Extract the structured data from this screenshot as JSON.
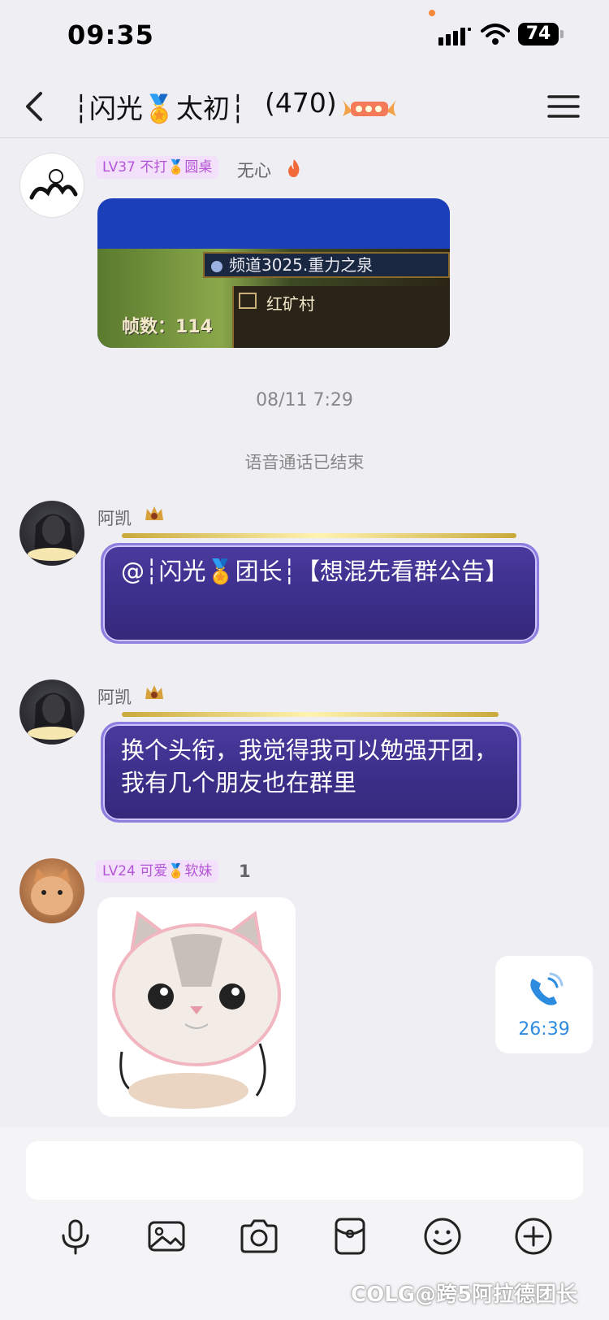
{
  "status_bar": {
    "time": "09:35",
    "battery": "74"
  },
  "header": {
    "title": "┆闪光🏅太初┆",
    "member_count": "(470)"
  },
  "messages": [
    {
      "level": "LV37 不打🏅圆桌",
      "name": "无心",
      "image_lines": [
        "频道3025.重力之泉",
        "红矿村",
        "帧数：114"
      ]
    },
    {
      "timestamp": "08/11 7:29"
    },
    {
      "system": "语音通话已结束"
    },
    {
      "name": "阿凯",
      "text": "@┆闪光🏅团长┆【想混先看群公告】"
    },
    {
      "name": "阿凯",
      "text": "换个头衔，我觉得我可以勉强开团，我有几个朋友也在群里"
    },
    {
      "level": "LV24 可爱🏅软妹",
      "name": "1"
    }
  ],
  "call": {
    "duration": "26:39"
  },
  "input": {
    "placeholder": ""
  },
  "toolbar": [
    "mic-icon",
    "image-icon",
    "camera-icon",
    "red-packet-icon",
    "emoji-icon",
    "plus-icon"
  ],
  "watermark": "COLG@跨5阿拉德团长",
  "colors": {
    "accent": "#2d8be0",
    "level_tag_bg": "#f3e0fa",
    "level_tag_text": "#b455d8",
    "bubble_bg": "#3d2f8f"
  }
}
